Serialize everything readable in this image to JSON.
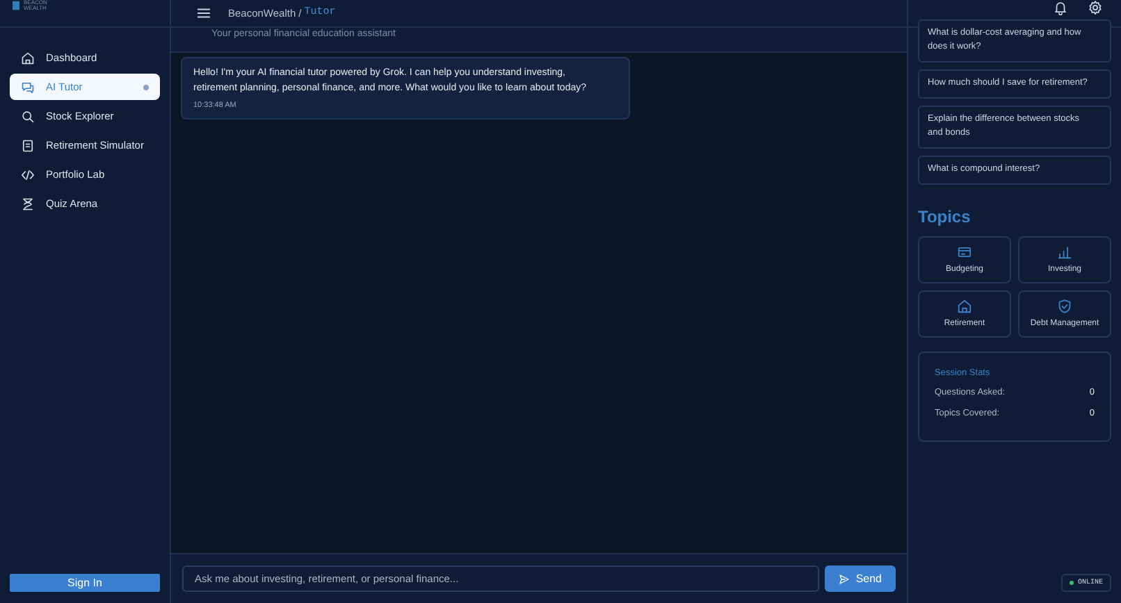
{
  "logo": {
    "lines": [
      "BEACON",
      "WEALTH"
    ]
  },
  "sidebar": {
    "items": [
      {
        "label": "Dashboard",
        "selected": false
      },
      {
        "label": "AI Tutor",
        "selected": true
      },
      {
        "label": "Stock Explorer",
        "selected": false
      },
      {
        "label": "Retirement Simulator",
        "selected": false
      },
      {
        "label": "Portfolio Lab",
        "selected": false
      },
      {
        "label": "Quiz Arena",
        "selected": false
      }
    ],
    "sign_in": "Sign In"
  },
  "header": {
    "breadcrumb": [
      "BeaconWealth",
      "Tutor"
    ],
    "separator": "/"
  },
  "chat": {
    "subtitle": "Your personal financial education assistant",
    "messages": [
      {
        "text": "Hello! I'm your AI financial tutor powered by Grok. I can help you understand investing, retirement planning, personal finance, and more. What would you like to learn about today?",
        "time": "10:33:48 AM"
      }
    ],
    "input": {
      "placeholder": "Ask me about investing, retirement, or personal finance..."
    },
    "send": "Send"
  },
  "suggestions": [
    "What is dollar-cost averaging and how does it work?",
    "How much should I save for retirement?",
    "Explain the difference between stocks and bonds",
    "What is compound interest?"
  ],
  "topics": {
    "title": "Topics",
    "items": [
      {
        "label": "Budgeting"
      },
      {
        "label": "Investing"
      },
      {
        "label": "Retirement"
      },
      {
        "label": "Debt Management"
      }
    ]
  },
  "session_stats": {
    "title": "Session Stats",
    "rows": [
      {
        "label": "Questions Asked:",
        "value": "0"
      },
      {
        "label": "Topics Covered:",
        "value": "0"
      }
    ]
  },
  "status": {
    "label": "ONLINE",
    "online": true
  }
}
